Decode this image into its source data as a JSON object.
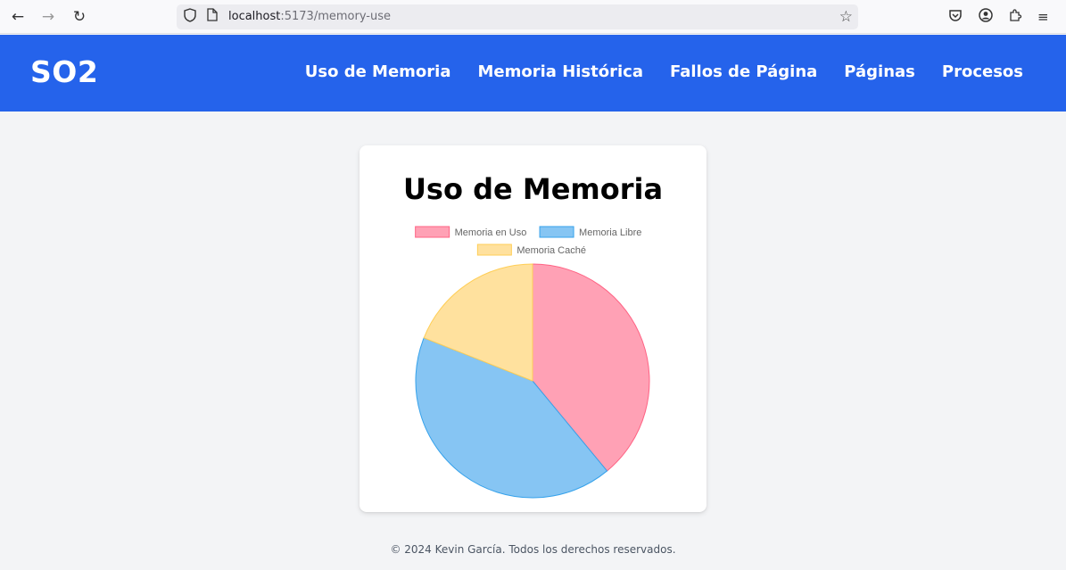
{
  "browser": {
    "url_host": "localhost",
    "url_path": ":5173/memory-use"
  },
  "app": {
    "brand": "SO2",
    "nav": [
      "Uso de Memoria",
      "Memoria Histórica",
      "Fallos de Página",
      "Páginas",
      "Procesos"
    ]
  },
  "card": {
    "title": "Uso de Memoria"
  },
  "chart_data": {
    "type": "pie",
    "title": "Uso de Memoria",
    "labels": [
      "Memoria en Uso",
      "Memoria Libre",
      "Memoria Caché"
    ],
    "values": [
      39,
      42,
      19
    ],
    "colors": [
      "#ffa1b5",
      "#86c5f3",
      "#ffe19e"
    ],
    "border_colors": [
      "#ff6384",
      "#36a2eb",
      "#ffce56"
    ],
    "legend_position": "top"
  },
  "footer": {
    "text": "© 2024 Kevin García. Todos los derechos reservados."
  }
}
